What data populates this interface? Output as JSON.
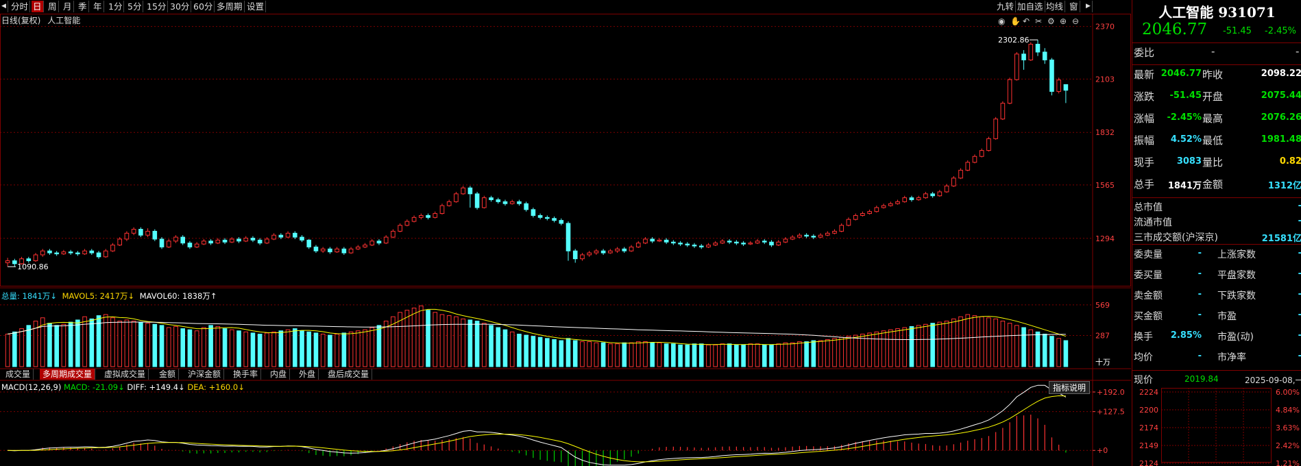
{
  "toolbar": {
    "items": [
      "分时",
      "日",
      "周",
      "月",
      "季",
      "年",
      "1分",
      "5分",
      "15分",
      "30分",
      "60分",
      "多周期",
      "设置"
    ],
    "active_index": 1,
    "right_items": [
      "九转",
      "加自选",
      "均线",
      "窗"
    ]
  },
  "chart_header": {
    "period_label": "日线(复权)",
    "instrument": "人工智能"
  },
  "price_axis": {
    "ticks": [
      "2370",
      "2103",
      "1832",
      "1565",
      "1294"
    ]
  },
  "annotations": {
    "high": "2302.86",
    "low": "1090.86"
  },
  "volume_header": {
    "total": "总量: 1841万↓",
    "mavol5": "MAVOL5: 2417万↓",
    "mavol60": "MAVOL60: 1838万↑"
  },
  "volume_axis": {
    "ticks": [
      "569",
      "287"
    ],
    "unit": "十万"
  },
  "indicator_tabs": {
    "items": [
      "成交量",
      "多周期成交量",
      "虚拟成交量",
      "金额",
      "沪深金额",
      "换手率",
      "内盘",
      "外盘",
      "盘后成交量"
    ],
    "active_index": 1
  },
  "macd_header": {
    "name": "MACD(12,26,9)",
    "macd": "MACD: -21.09↓",
    "diff": "DIFF: +149.4↓",
    "dea": "DEA: +160.0↓"
  },
  "macd_axis": {
    "ticks": [
      "+192.0",
      "+127.5",
      "+0"
    ]
  },
  "indicator_help": "指标说明",
  "quote": {
    "title": "人工智能 931071",
    "price": "2046.77",
    "change": "-51.45",
    "change_pct": "-2.45%",
    "weibi_label": "委比",
    "weibi_value": "-",
    "weibi_value2": "-",
    "rows": [
      {
        "l1": "最新",
        "v1": "2046.77",
        "c1": "green",
        "l2": "昨收",
        "v2": "2098.22",
        "c2": "white"
      },
      {
        "l1": "涨跌",
        "v1": "-51.45",
        "c1": "green",
        "l2": "开盘",
        "v2": "2075.44",
        "c2": "green"
      },
      {
        "l1": "涨幅",
        "v1": "-2.45%",
        "c1": "green",
        "l2": "最高",
        "v2": "2076.26",
        "c2": "green"
      },
      {
        "l1": "振幅",
        "v1": "4.52%",
        "c1": "cyan",
        "l2": "最低",
        "v2": "1981.48",
        "c2": "green"
      },
      {
        "l1": "现手",
        "v1": "3083",
        "c1": "cyan",
        "l2": "量比",
        "v2": "0.82",
        "c2": "yellow"
      },
      {
        "l1": "总手",
        "v1": "1841万",
        "c1": "white",
        "l2": "金额",
        "v2": "1312亿",
        "c2": "cyan"
      }
    ],
    "market": [
      {
        "label": "总市值",
        "value": "-"
      },
      {
        "label": "流通市值",
        "value": "-"
      },
      {
        "label": "三市成交额(沪深京)",
        "value": "21581亿"
      }
    ],
    "stats": [
      {
        "l1": "委卖量",
        "v1": "-",
        "l2": "上涨家数",
        "v2": "-"
      },
      {
        "l1": "委买量",
        "v1": "-",
        "l2": "平盘家数",
        "v2": "-"
      },
      {
        "l1": "卖金额",
        "v1": "-",
        "l2": "下跌家数",
        "v2": "-"
      },
      {
        "l1": "买金额",
        "v1": "-",
        "l2": "市盈",
        "v2": "-"
      },
      {
        "l1": "换手",
        "v1": "2.85%",
        "l2": "市盈(动)",
        "v2": "-"
      },
      {
        "l1": "均价",
        "v1": "-",
        "l2": "市净率",
        "v2": "-"
      }
    ],
    "spot_label": "现价",
    "spot_value": "2019.84",
    "spot_date": "2025-09-08,一"
  },
  "mini_chart": {
    "price_ticks": [
      "2224",
      "2200",
      "2174",
      "2149",
      "2124"
    ],
    "pct_ticks": [
      "6.00%",
      "4.84%",
      "3.63%",
      "2.42%",
      "1.21%"
    ]
  },
  "colors": {
    "up": "#ff3232",
    "down": "#54ffff",
    "grid": "#800000",
    "ma5": "#ffffff",
    "ma10": "#ffff00"
  },
  "chart_data": {
    "type": "candlestick",
    "price_range": [
      1060,
      2400
    ],
    "candles": [
      [
        1170,
        1180,
        1150,
        1195
      ],
      [
        1180,
        1165,
        1150,
        1190
      ],
      [
        1165,
        1190,
        1160,
        1200
      ],
      [
        1190,
        1180,
        1170,
        1200
      ],
      [
        1180,
        1210,
        1175,
        1220
      ],
      [
        1210,
        1230,
        1200,
        1240
      ],
      [
        1230,
        1220,
        1210,
        1240
      ],
      [
        1220,
        1215,
        1205,
        1230
      ],
      [
        1215,
        1225,
        1210,
        1235
      ],
      [
        1225,
        1220,
        1210,
        1235
      ],
      [
        1220,
        1215,
        1205,
        1230
      ],
      [
        1215,
        1230,
        1210,
        1240
      ],
      [
        1230,
        1220,
        1210,
        1240
      ],
      [
        1220,
        1200,
        1190,
        1230
      ],
      [
        1200,
        1230,
        1195,
        1240
      ],
      [
        1230,
        1260,
        1225,
        1270
      ],
      [
        1260,
        1290,
        1255,
        1300
      ],
      [
        1290,
        1320,
        1280,
        1330
      ],
      [
        1320,
        1340,
        1310,
        1350
      ],
      [
        1340,
        1310,
        1300,
        1350
      ],
      [
        1310,
        1330,
        1300,
        1345
      ],
      [
        1330,
        1290,
        1280,
        1340
      ],
      [
        1290,
        1250,
        1240,
        1300
      ],
      [
        1250,
        1280,
        1245,
        1290
      ],
      [
        1280,
        1300,
        1270,
        1310
      ],
      [
        1300,
        1270,
        1260,
        1310
      ],
      [
        1270,
        1250,
        1240,
        1280
      ],
      [
        1250,
        1265,
        1245,
        1275
      ],
      [
        1265,
        1280,
        1260,
        1290
      ],
      [
        1280,
        1270,
        1260,
        1290
      ],
      [
        1270,
        1285,
        1265,
        1295
      ],
      [
        1285,
        1275,
        1265,
        1295
      ],
      [
        1275,
        1290,
        1270,
        1300
      ],
      [
        1290,
        1280,
        1270,
        1300
      ],
      [
        1280,
        1295,
        1275,
        1305
      ],
      [
        1295,
        1285,
        1275,
        1305
      ],
      [
        1285,
        1270,
        1260,
        1295
      ],
      [
        1270,
        1290,
        1265,
        1300
      ],
      [
        1290,
        1310,
        1285,
        1320
      ],
      [
        1310,
        1300,
        1290,
        1320
      ],
      [
        1300,
        1320,
        1295,
        1330
      ],
      [
        1320,
        1300,
        1290,
        1330
      ],
      [
        1300,
        1285,
        1275,
        1310
      ],
      [
        1285,
        1250,
        1240,
        1290
      ],
      [
        1250,
        1230,
        1220,
        1260
      ],
      [
        1230,
        1240,
        1220,
        1250
      ],
      [
        1240,
        1225,
        1215,
        1250
      ],
      [
        1225,
        1240,
        1220,
        1250
      ],
      [
        1240,
        1220,
        1210,
        1250
      ],
      [
        1220,
        1240,
        1215,
        1250
      ],
      [
        1240,
        1250,
        1235,
        1260
      ],
      [
        1250,
        1260,
        1245,
        1270
      ],
      [
        1260,
        1280,
        1255,
        1290
      ],
      [
        1280,
        1270,
        1260,
        1290
      ],
      [
        1270,
        1300,
        1265,
        1310
      ],
      [
        1300,
        1330,
        1295,
        1340
      ],
      [
        1330,
        1360,
        1325,
        1370
      ],
      [
        1360,
        1380,
        1355,
        1390
      ],
      [
        1380,
        1400,
        1375,
        1410
      ],
      [
        1400,
        1410,
        1390,
        1420
      ],
      [
        1410,
        1400,
        1390,
        1420
      ],
      [
        1400,
        1420,
        1395,
        1430
      ],
      [
        1420,
        1460,
        1415,
        1470
      ],
      [
        1460,
        1480,
        1455,
        1490
      ],
      [
        1480,
        1520,
        1475,
        1530
      ],
      [
        1520,
        1550,
        1515,
        1560
      ],
      [
        1550,
        1520,
        1450,
        1560
      ],
      [
        1520,
        1450,
        1440,
        1530
      ],
      [
        1450,
        1500,
        1445,
        1510
      ],
      [
        1500,
        1490,
        1480,
        1510
      ],
      [
        1490,
        1480,
        1470,
        1500
      ],
      [
        1480,
        1470,
        1460,
        1490
      ],
      [
        1470,
        1480,
        1465,
        1490
      ],
      [
        1480,
        1470,
        1460,
        1490
      ],
      [
        1470,
        1440,
        1430,
        1480
      ],
      [
        1440,
        1410,
        1400,
        1450
      ],
      [
        1410,
        1400,
        1390,
        1420
      ],
      [
        1400,
        1395,
        1385,
        1410
      ],
      [
        1395,
        1385,
        1375,
        1405
      ],
      [
        1385,
        1370,
        1360,
        1395
      ],
      [
        1370,
        1230,
        1180,
        1380
      ],
      [
        1230,
        1190,
        1170,
        1240
      ],
      [
        1190,
        1210,
        1180,
        1220
      ],
      [
        1210,
        1220,
        1200,
        1230
      ],
      [
        1220,
        1230,
        1210,
        1240
      ],
      [
        1230,
        1220,
        1210,
        1240
      ],
      [
        1220,
        1230,
        1215,
        1240
      ],
      [
        1230,
        1240,
        1220,
        1250
      ],
      [
        1240,
        1230,
        1220,
        1250
      ],
      [
        1230,
        1250,
        1225,
        1260
      ],
      [
        1250,
        1270,
        1245,
        1280
      ],
      [
        1270,
        1290,
        1265,
        1300
      ],
      [
        1290,
        1280,
        1270,
        1300
      ],
      [
        1280,
        1285,
        1275,
        1295
      ],
      [
        1285,
        1275,
        1265,
        1295
      ],
      [
        1275,
        1270,
        1260,
        1285
      ],
      [
        1270,
        1265,
        1255,
        1280
      ],
      [
        1265,
        1260,
        1250,
        1275
      ],
      [
        1260,
        1255,
        1245,
        1270
      ],
      [
        1255,
        1250,
        1240,
        1265
      ],
      [
        1250,
        1260,
        1245,
        1270
      ],
      [
        1260,
        1270,
        1255,
        1280
      ],
      [
        1270,
        1280,
        1265,
        1290
      ],
      [
        1280,
        1275,
        1265,
        1290
      ],
      [
        1275,
        1270,
        1260,
        1285
      ],
      [
        1270,
        1265,
        1255,
        1280
      ],
      [
        1265,
        1270,
        1260,
        1280
      ],
      [
        1270,
        1280,
        1265,
        1290
      ],
      [
        1280,
        1275,
        1265,
        1290
      ],
      [
        1275,
        1260,
        1250,
        1285
      ],
      [
        1260,
        1275,
        1255,
        1285
      ],
      [
        1275,
        1290,
        1270,
        1300
      ],
      [
        1290,
        1300,
        1285,
        1310
      ],
      [
        1300,
        1310,
        1295,
        1320
      ],
      [
        1310,
        1305,
        1295,
        1320
      ],
      [
        1305,
        1300,
        1290,
        1315
      ],
      [
        1300,
        1310,
        1295,
        1320
      ],
      [
        1310,
        1320,
        1305,
        1330
      ],
      [
        1320,
        1330,
        1315,
        1340
      ],
      [
        1330,
        1360,
        1325,
        1370
      ],
      [
        1360,
        1390,
        1355,
        1400
      ],
      [
        1390,
        1410,
        1385,
        1420
      ],
      [
        1410,
        1420,
        1405,
        1430
      ],
      [
        1420,
        1430,
        1415,
        1440
      ],
      [
        1430,
        1450,
        1425,
        1460
      ],
      [
        1450,
        1460,
        1445,
        1470
      ],
      [
        1460,
        1470,
        1455,
        1480
      ],
      [
        1470,
        1480,
        1465,
        1490
      ],
      [
        1480,
        1500,
        1475,
        1510
      ],
      [
        1500,
        1490,
        1480,
        1510
      ],
      [
        1490,
        1500,
        1485,
        1510
      ],
      [
        1500,
        1520,
        1495,
        1530
      ],
      [
        1520,
        1510,
        1500,
        1530
      ],
      [
        1510,
        1530,
        1505,
        1540
      ],
      [
        1530,
        1560,
        1525,
        1570
      ],
      [
        1560,
        1600,
        1555,
        1610
      ],
      [
        1600,
        1640,
        1595,
        1650
      ],
      [
        1640,
        1680,
        1635,
        1690
      ],
      [
        1680,
        1710,
        1675,
        1720
      ],
      [
        1710,
        1740,
        1705,
        1750
      ],
      [
        1740,
        1800,
        1735,
        1810
      ],
      [
        1800,
        1900,
        1795,
        1910
      ],
      [
        1900,
        1980,
        1895,
        1990
      ],
      [
        1980,
        2100,
        1975,
        2110
      ],
      [
        2100,
        2230,
        2095,
        2240
      ],
      [
        2230,
        2200,
        2150,
        2250
      ],
      [
        2200,
        2280,
        2195,
        2290
      ],
      [
        2280,
        2240,
        2220,
        2302
      ],
      [
        2240,
        2200,
        2180,
        2260
      ],
      [
        2200,
        2040,
        2020,
        2210
      ],
      [
        2040,
        2098,
        2030,
        2110
      ],
      [
        2075,
        2046,
        1981,
        2076
      ]
    ],
    "volumes": [
      300,
      320,
      350,
      380,
      420,
      450,
      400,
      380,
      390,
      410,
      430,
      460,
      440,
      470,
      480,
      450,
      420,
      430,
      420,
      410,
      400,
      390,
      380,
      360,
      370,
      350,
      340,
      330,
      360,
      380,
      370,
      350,
      340,
      330,
      320,
      310,
      300,
      310,
      320,
      330,
      340,
      350,
      330,
      320,
      310,
      300,
      290,
      300,
      310,
      320,
      330,
      340,
      360,
      380,
      420,
      460,
      500,
      520,
      540,
      560,
      520,
      500,
      480,
      470,
      460,
      440,
      430,
      420,
      400,
      380,
      360,
      340,
      320,
      300,
      290,
      280,
      270,
      260,
      250,
      240,
      260,
      240,
      230,
      230,
      220,
      220,
      210,
      210,
      220,
      220,
      230,
      230,
      220,
      220,
      210,
      210,
      200,
      200,
      210,
      210,
      200,
      200,
      210,
      210,
      200,
      200,
      210,
      210,
      200,
      200,
      210,
      220,
      220,
      230,
      230,
      240,
      240,
      250,
      260,
      270,
      280,
      290,
      300,
      310,
      320,
      330,
      340,
      350,
      360,
      370,
      380,
      390,
      400,
      410,
      420,
      440,
      460,
      480,
      470,
      460,
      450,
      440,
      420,
      400,
      380,
      360,
      340,
      320,
      300,
      280,
      260,
      240
    ]
  }
}
